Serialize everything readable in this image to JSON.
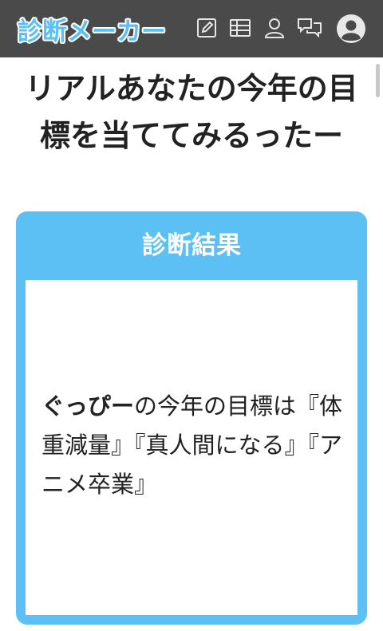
{
  "header": {
    "logo_text": "診断メーカー",
    "icons": [
      "edit-icon",
      "table-icon",
      "user-icon",
      "chat-icon",
      "avatar-icon"
    ]
  },
  "page": {
    "title": "リアルあなたの今年の目標を当ててみるったー"
  },
  "result": {
    "heading": "診断結果",
    "user_name": "ぐっぴー",
    "text": "の今年の目標は『体重減量』『真人間になる』『アニメ卒業』"
  },
  "colors": {
    "topbar": "#4a4a4a",
    "accent": "#5cc0f4",
    "text": "#222222"
  }
}
